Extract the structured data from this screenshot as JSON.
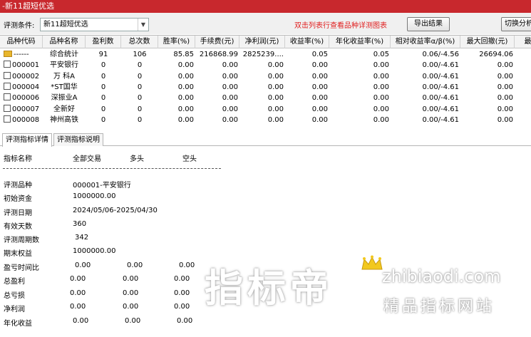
{
  "window": {
    "title": "-新11超短优选"
  },
  "toolbar": {
    "condition_label": "评测条件:",
    "condition_value": "新11超短优选",
    "hint": "双击列表行查看品种详测图表",
    "export_label": "导出结果",
    "switch_label": "切换分析"
  },
  "grid": {
    "columns": [
      "品种代码",
      "品种名称",
      "盈利数",
      "总次数",
      "胜率(%)",
      "手续费(元)",
      "净利润(元)",
      "收益率(%)",
      "年化收益率(%)",
      "相对收益率α/β(%)",
      "最大回撤(元)",
      "最"
    ],
    "rows": [
      {
        "code": "------",
        "name": "综合统计",
        "wins": "91",
        "total": "106",
        "winrate": "85.85",
        "fee": "216868.99",
        "profit": "2825239....",
        "ret": "0.05",
        "annual": "0.05",
        "relative": "0.06/-4.56",
        "drawdown": "26694.06"
      },
      {
        "code": "000001",
        "name": "平安银行",
        "wins": "0",
        "total": "0",
        "winrate": "0.00",
        "fee": "0.00",
        "profit": "0.00",
        "ret": "0.00",
        "annual": "0.00",
        "relative": "0.00/-4.61",
        "drawdown": "0.00"
      },
      {
        "code": "000002",
        "name": "万 科A",
        "wins": "0",
        "total": "0",
        "winrate": "0.00",
        "fee": "0.00",
        "profit": "0.00",
        "ret": "0.00",
        "annual": "0.00",
        "relative": "0.00/-4.61",
        "drawdown": "0.00"
      },
      {
        "code": "000004",
        "name": "*ST国华",
        "wins": "0",
        "total": "0",
        "winrate": "0.00",
        "fee": "0.00",
        "profit": "0.00",
        "ret": "0.00",
        "annual": "0.00",
        "relative": "0.00/-4.61",
        "drawdown": "0.00"
      },
      {
        "code": "000006",
        "name": "深振业A",
        "wins": "0",
        "total": "0",
        "winrate": "0.00",
        "fee": "0.00",
        "profit": "0.00",
        "ret": "0.00",
        "annual": "0.00",
        "relative": "0.00/-4.61",
        "drawdown": "0.00"
      },
      {
        "code": "000007",
        "name": "全新好",
        "wins": "0",
        "total": "0",
        "winrate": "0.00",
        "fee": "0.00",
        "profit": "0.00",
        "ret": "0.00",
        "annual": "0.00",
        "relative": "0.00/-4.61",
        "drawdown": "0.00"
      },
      {
        "code": "000008",
        "name": "神州高铁",
        "wins": "0",
        "total": "0",
        "winrate": "0.00",
        "fee": "0.00",
        "profit": "0.00",
        "ret": "0.00",
        "annual": "0.00",
        "relative": "0.00/-4.61",
        "drawdown": "0.00"
      }
    ]
  },
  "tabs": [
    {
      "label": "评测指标详情",
      "active": true
    },
    {
      "label": "评测指标说明",
      "active": false
    }
  ],
  "detail": {
    "header": {
      "name": "指标名称",
      "all": "全部交易",
      "long": "多头",
      "short": "空头"
    },
    "info": [
      {
        "label": "评测品种",
        "value": "000001-平安银行"
      },
      {
        "label": "初始资金",
        "value": "1000000.00"
      },
      {
        "label": "评测日期",
        "value": "2024/05/06-2025/04/30"
      },
      {
        "label": "有效天数",
        "value": "360"
      },
      {
        "label": "评测周期数",
        "value": "342"
      },
      {
        "label": "期末权益",
        "value": "1000000.00"
      }
    ],
    "metrics": [
      {
        "label": "盈亏时间比",
        "all": "0.00",
        "long": "0.00",
        "short": "0.00"
      },
      {
        "label": "总盈利",
        "all": "0.00",
        "long": "0.00",
        "short": "0.00"
      },
      {
        "label": "总亏损",
        "all": "0.00",
        "long": "0.00",
        "short": "0.00"
      },
      {
        "label": "净利润",
        "all": "0.00",
        "long": "0.00",
        "short": "0.00"
      },
      {
        "label": "年化收益",
        "all": "0.00",
        "long": "0.00",
        "short": "0.00"
      }
    ]
  },
  "watermark": {
    "brand": "指标帝",
    "url": "zhibiaodi.com",
    "tagline": "精品指标网站"
  },
  "colors": {
    "titlebar": "#c8282d",
    "hint": "#e02020",
    "folder": "#e8b62c"
  }
}
